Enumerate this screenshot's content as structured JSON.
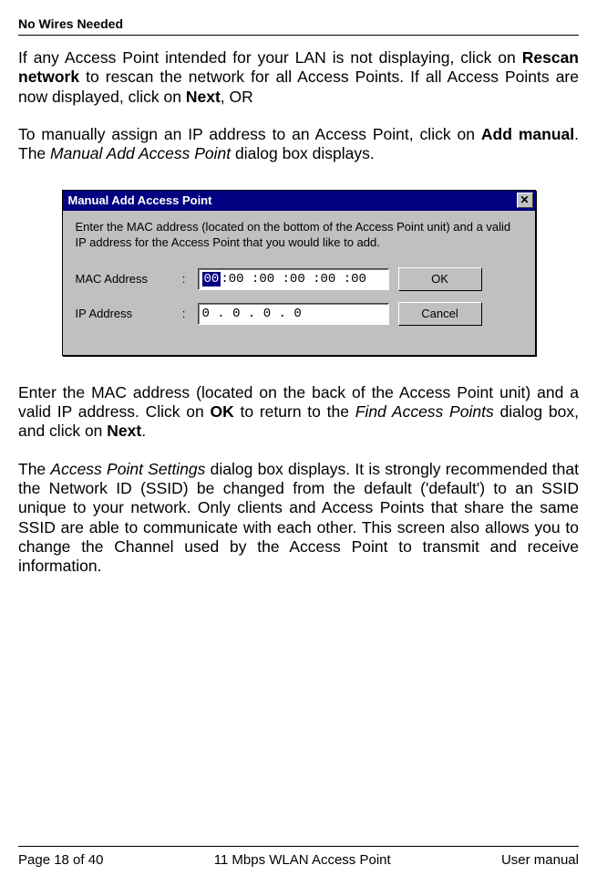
{
  "header": {
    "brand": "No Wires Needed"
  },
  "para1": {
    "pre": "If any Access Point intended for your LAN is not displaying, click on ",
    "b1": "Rescan network",
    "mid": " to rescan the network for all Access Points. If all Access Points are now displayed, click on ",
    "b2": "Next",
    "post": ", OR"
  },
  "para2": {
    "pre": "To manually assign an IP address to an Access Point, click on ",
    "b1": "Add manual",
    "post1": ". The ",
    "i1": "Manual Add Access Point",
    "post2": " dialog box displays."
  },
  "dialog": {
    "title": "Manual Add Access Point",
    "close": "✕",
    "instruction": "Enter the MAC address (located on the bottom of the Access Point unit) and a valid IP address for the Access Point that you would like to add.",
    "mac_label": "MAC Address",
    "ip_label": "IP Address",
    "mac_sel": "00",
    "mac_rest": " :00 :00 :00 :00 :00",
    "ip_value": " 0  .  0  .  0  .  0",
    "ok": "OK",
    "cancel": "Cancel"
  },
  "para3": {
    "pre": "Enter the MAC address (located on the back of the Access Point unit) and a valid IP address. Click on ",
    "b1": "OK",
    "mid": " to return to the ",
    "i1": "Find Access Points",
    "mid2": " dialog box, and click on ",
    "b2": "Next",
    "post": "."
  },
  "para4": {
    "pre": "The ",
    "i1": "Access Point Settings",
    "post": " dialog box displays. It is strongly recommended that the Network ID (SSID) be changed from the default ('default') to an SSID unique to your network. Only clients and Access Points that share the same SSID are able to communicate with each other. This screen also allows you to change the Channel used by the Access Point to transmit and receive information."
  },
  "footer": {
    "left": "Page 18 of 40",
    "center_a": "11 Mbps WLAN ",
    "center_b": "Access Point",
    "right": "User manual"
  }
}
